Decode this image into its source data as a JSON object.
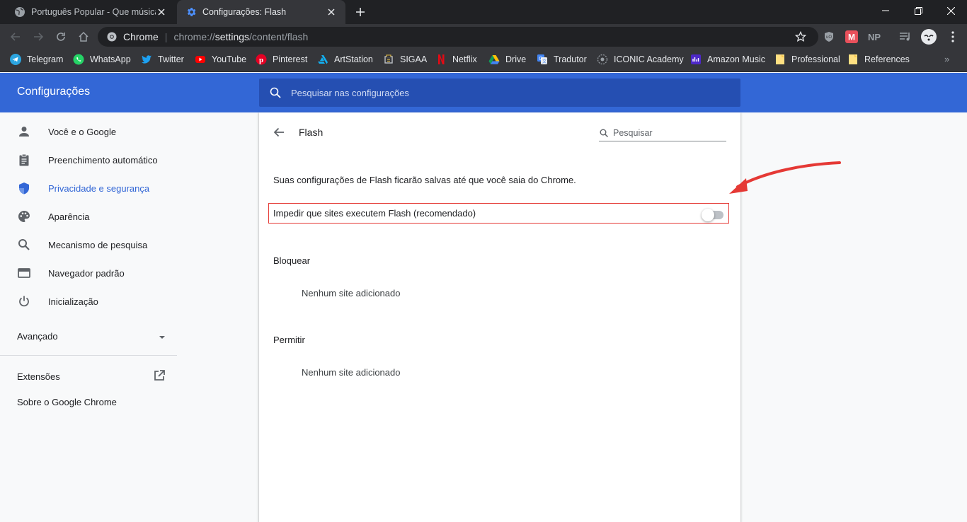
{
  "tabs": [
    {
      "title": "Português Popular - Que música",
      "icon": "globe-icon"
    },
    {
      "title": "Configurações: Flash",
      "icon": "gear-icon"
    }
  ],
  "toolbar": {
    "omnibox_site": "Chrome",
    "url_scheme": "chrome://",
    "url_host": "settings",
    "url_path": "/content/flash",
    "extensions": [
      "ublock-icon",
      "m-icon",
      "np-icon",
      "media-icon",
      "avatar-icon"
    ]
  },
  "bookmarks": [
    {
      "label": "Telegram",
      "icon": "telegram-icon"
    },
    {
      "label": "WhatsApp",
      "icon": "whatsapp-icon"
    },
    {
      "label": "Twitter",
      "icon": "twitter-icon"
    },
    {
      "label": "YouTube",
      "icon": "youtube-icon"
    },
    {
      "label": "Pinterest",
      "icon": "pinterest-icon"
    },
    {
      "label": "ArtStation",
      "icon": "artstation-icon"
    },
    {
      "label": "SIGAA",
      "icon": "sigaa-icon"
    },
    {
      "label": "Netflix",
      "icon": "netflix-icon"
    },
    {
      "label": "Drive",
      "icon": "drive-icon"
    },
    {
      "label": "Tradutor",
      "icon": "translate-icon"
    },
    {
      "label": "ICONIC Academy",
      "icon": "iconic-icon"
    },
    {
      "label": "Amazon Music",
      "icon": "amazon-music-icon"
    },
    {
      "label": "Professional",
      "icon": "folder-icon"
    },
    {
      "label": "References",
      "icon": "folder-icon"
    }
  ],
  "header": {
    "title": "Configurações",
    "search_placeholder": "Pesquisar nas configurações"
  },
  "sidebar": {
    "items": [
      {
        "label": "Você e o Google",
        "icon": "person-icon"
      },
      {
        "label": "Preenchimento automático",
        "icon": "clipboard-icon"
      },
      {
        "label": "Privacidade e segurança",
        "icon": "shield-icon",
        "active": true
      },
      {
        "label": "Aparência",
        "icon": "palette-icon"
      },
      {
        "label": "Mecanismo de pesquisa",
        "icon": "search-icon"
      },
      {
        "label": "Navegador padrão",
        "icon": "browser-icon"
      },
      {
        "label": "Inicialização",
        "icon": "power-icon"
      }
    ],
    "advanced": "Avançado",
    "extensions": "Extensões",
    "about": "Sobre o Google Chrome"
  },
  "page": {
    "title": "Flash",
    "search_placeholder": "Pesquisar",
    "info": "Suas configurações de Flash ficarão salvas até que você saia do Chrome.",
    "toggle_label": "Impedir que sites executem Flash (recomendado)",
    "toggle_on": false,
    "block_heading": "Bloquear",
    "block_empty": "Nenhum site adicionado",
    "allow_heading": "Permitir",
    "allow_empty": "Nenhum site adicionado"
  },
  "colors": {
    "accent": "#3367d6",
    "highlight": "#e53935"
  }
}
